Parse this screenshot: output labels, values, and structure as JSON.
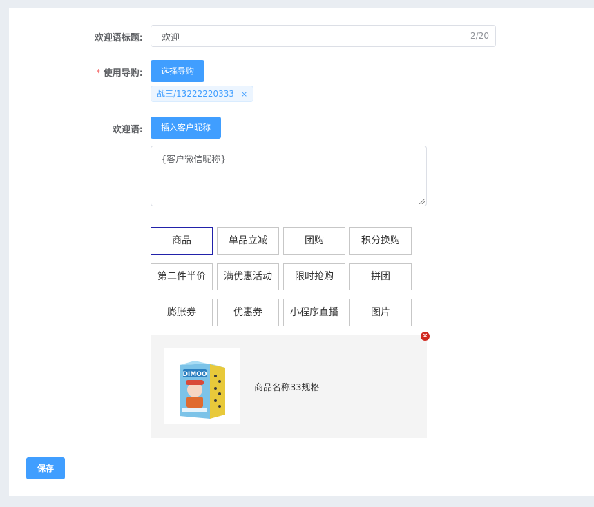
{
  "form": {
    "title_label": "欢迎语标题:",
    "title_value": "欢迎",
    "title_count": "2/20",
    "guide_required": "*",
    "guide_label": "使用导购:",
    "guide_button": "选择导购",
    "guide_tag": "战三/13222220333",
    "guide_tag_close": "×",
    "welcome_label": "欢迎语:",
    "insert_button": "插入客户昵称",
    "welcome_text": "{客户微信昵称}"
  },
  "attachments": {
    "options": [
      "商品",
      "单品立减",
      "团购",
      "积分换购",
      "第二件半价",
      "满优惠活动",
      "限时抢购",
      "拼团",
      "膨胀券",
      "优惠券",
      "小程序直播",
      "图片"
    ],
    "selected": "商品",
    "preview": {
      "name": "商品名称33规格",
      "image_text": "DIMOO",
      "remove_icon": "×"
    }
  },
  "footer": {
    "save_label": "保存"
  },
  "colors": {
    "primary": "#409eff",
    "danger": "#d0281f",
    "active_border": "#2222aa"
  }
}
